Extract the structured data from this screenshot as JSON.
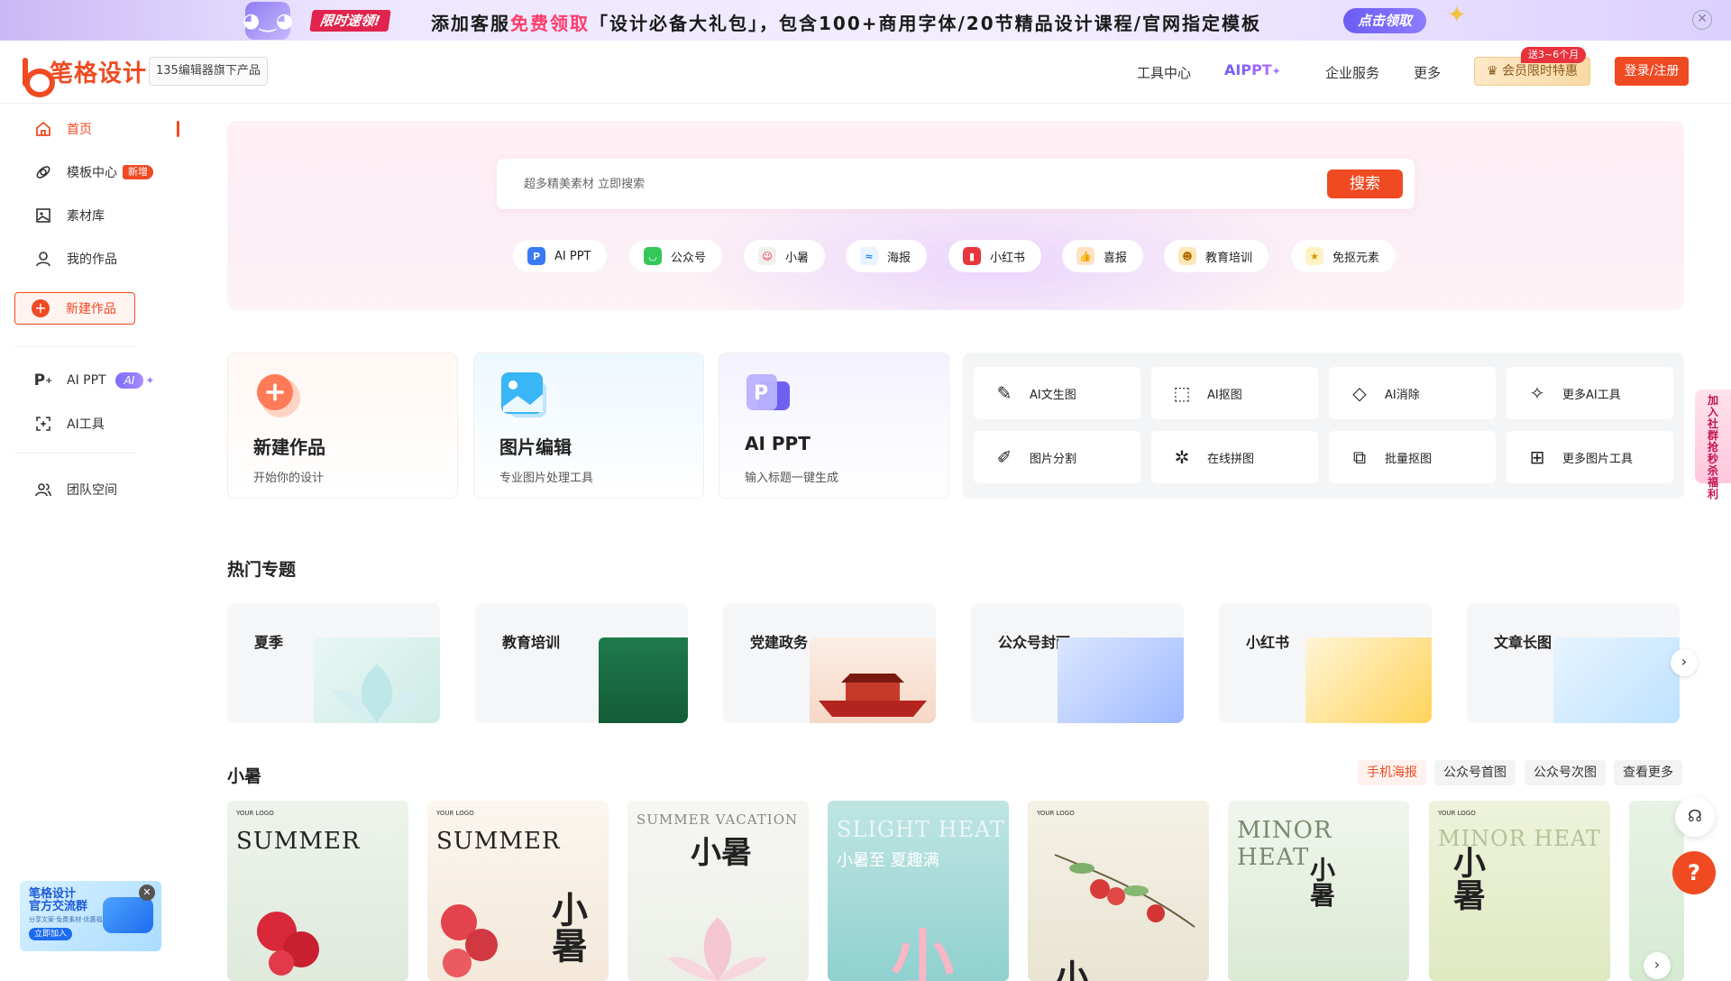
{
  "banner": {
    "tag": "限时速领!",
    "text_prefix": "添加客服",
    "text_highlight": "免费领取",
    "text_suffix": "「设计必备大礼包」，包含100+商用字体/20节精品设计课程/官网指定模板",
    "button": "点击领取",
    "close": "✕"
  },
  "header": {
    "logo_text": "笔格设计",
    "logo_sub": "135编辑器旗下产品",
    "nav": [
      "工具中心",
      "AIPPT",
      "企业服务",
      "更多"
    ],
    "ai_star": "✦",
    "vip_label": "会员限时特惠",
    "vip_badge": "送3~6个月",
    "login": "登录/注册"
  },
  "sidebar": {
    "items": [
      {
        "label": "首页"
      },
      {
        "label": "模板中心",
        "badge": "新增"
      },
      {
        "label": "素材库"
      },
      {
        "label": "我的作品"
      }
    ],
    "new_work": "新建作品",
    "ai_items": [
      {
        "label": "AI PPT",
        "badge": "AI"
      },
      {
        "label": "AI工具"
      }
    ],
    "team": "团队空间",
    "promo": {
      "title_1": "笔格设计",
      "title_2": "官方交流群",
      "sub": "分享文案·免费素材·优惠福利",
      "join": "立即加入"
    }
  },
  "search": {
    "placeholder": "超多精美素材 立即搜索",
    "button": "搜索",
    "chips": [
      "AI PPT",
      "公众号",
      "小暑",
      "海报",
      "小红书",
      "喜报",
      "教育培训",
      "免抠元素"
    ]
  },
  "features": [
    {
      "title": "新建作品",
      "sub": "开始你的设计"
    },
    {
      "title": "图片编辑",
      "sub": "专业图片处理工具"
    },
    {
      "title": "AI PPT",
      "sub": "输入标题一键生成"
    }
  ],
  "tools": [
    "AI文生图",
    "AI抠图",
    "AI消除",
    "更多AI工具",
    "图片分割",
    "在线拼图",
    "批量抠图",
    "更多图片工具"
  ],
  "hot_topics": {
    "title": "热门专题",
    "items": [
      "夏季",
      "教育培训",
      "党建政务",
      "公众号封面",
      "小红书",
      "文章长图"
    ]
  },
  "xiaoshu": {
    "title": "小暑",
    "tabs": [
      "手机海报",
      "公众号首图",
      "公众号次图",
      "查看更多"
    ],
    "templates": [
      {
        "logo": "YOUR LOGO",
        "text": "SUMMER",
        "cn": ""
      },
      {
        "logo": "YOUR LOGO",
        "text": "SUMMER",
        "cn": "小暑"
      },
      {
        "logo": "",
        "text": "SUMMER VACATION",
        "cn": "小暑"
      },
      {
        "logo": "",
        "text": "SLIGHT HEAT",
        "cn": "小"
      },
      {
        "logo": "YOUR LOGO",
        "text": "",
        "cn": "小"
      },
      {
        "logo": "",
        "text": "MINOR HEAT",
        "cn": "小暑"
      },
      {
        "logo": "YOUR LOGO",
        "text": "MINOR HEAT",
        "cn": "小暑"
      }
    ]
  },
  "floating": {
    "tag": "加入社群抢秒杀福利",
    "help": "?"
  },
  "colors": {
    "brand": "#f04a23",
    "ai_purple": "#7a6cf8"
  }
}
